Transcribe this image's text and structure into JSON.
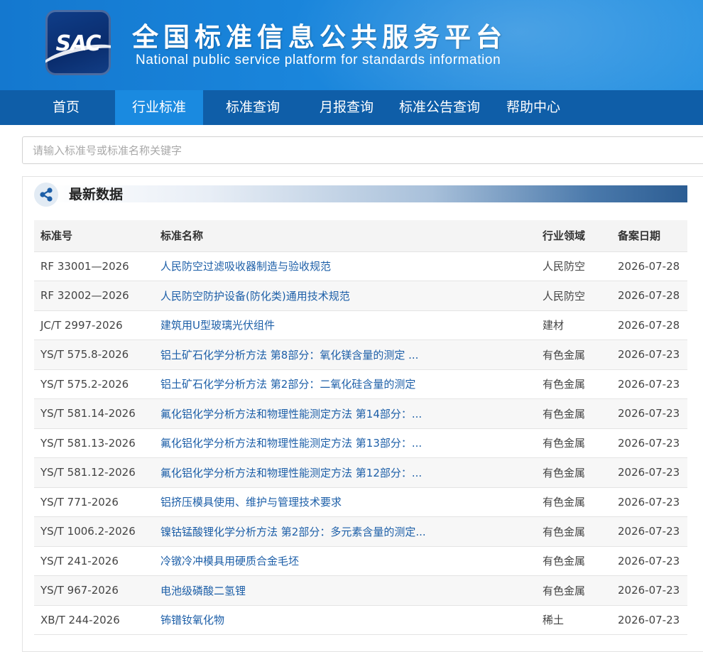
{
  "brand": {
    "logo_text": "SAC",
    "title": "全国标准信息公共服务平台",
    "subtitle": "National public service platform  for standards information"
  },
  "nav": {
    "items": [
      {
        "label": "首页",
        "active": false
      },
      {
        "label": "行业标准",
        "active": true
      },
      {
        "label": "标准查询",
        "active": false
      },
      {
        "label": "月报查询",
        "active": false
      },
      {
        "label": "标准公告查询",
        "active": false
      },
      {
        "label": "帮助中心",
        "active": false
      }
    ]
  },
  "search": {
    "placeholder": "请输入标准号或标准名称关键字",
    "value": ""
  },
  "latest": {
    "icon": "share-icon",
    "title": "最新数据",
    "columns": [
      "标准号",
      "标准名称",
      "行业领域",
      "备案日期"
    ],
    "rows": [
      {
        "code": "RF 33001—2026",
        "name": "人民防空过滤吸收器制造与验收规范",
        "field": "人民防空",
        "date": "2026-07-28"
      },
      {
        "code": "RF 32002—2026",
        "name": "人民防空防护设备(防化类)通用技术规范",
        "field": "人民防空",
        "date": "2026-07-28"
      },
      {
        "code": "JC/T 2997-2026",
        "name": "建筑用U型玻璃光伏组件",
        "field": "建材",
        "date": "2026-07-28"
      },
      {
        "code": "YS/T 575.8-2026",
        "name": "铝土矿石化学分析方法 第8部分：氧化镁含量的测定 ...",
        "field": "有色金属",
        "date": "2026-07-23"
      },
      {
        "code": "YS/T 575.2-2026",
        "name": "铝土矿石化学分析方法 第2部分：二氧化硅含量的测定",
        "field": "有色金属",
        "date": "2026-07-23"
      },
      {
        "code": "YS/T 581.14-2026",
        "name": "氟化铝化学分析方法和物理性能测定方法 第14部分：...",
        "field": "有色金属",
        "date": "2026-07-23"
      },
      {
        "code": "YS/T 581.13-2026",
        "name": "氟化铝化学分析方法和物理性能测定方法 第13部分：...",
        "field": "有色金属",
        "date": "2026-07-23"
      },
      {
        "code": "YS/T 581.12-2026",
        "name": "氟化铝化学分析方法和物理性能测定方法 第12部分：...",
        "field": "有色金属",
        "date": "2026-07-23"
      },
      {
        "code": "YS/T 771-2026",
        "name": "铝挤压模具使用、维护与管理技术要求",
        "field": "有色金属",
        "date": "2026-07-23"
      },
      {
        "code": "YS/T 1006.2-2026",
        "name": "镍钴锰酸锂化学分析方法 第2部分：多元素含量的测定...",
        "field": "有色金属",
        "date": "2026-07-23"
      },
      {
        "code": "YS/T 241-2026",
        "name": "冷镦冷冲模具用硬质合金毛坯",
        "field": "有色金属",
        "date": "2026-07-23"
      },
      {
        "code": "YS/T 967-2026",
        "name": "电池级磷酸二氢锂",
        "field": "有色金属",
        "date": "2026-07-23"
      },
      {
        "code": "XB/T 244-2026",
        "name": "钸镨钕氧化物",
        "field": "稀土",
        "date": "2026-07-23"
      }
    ]
  }
}
